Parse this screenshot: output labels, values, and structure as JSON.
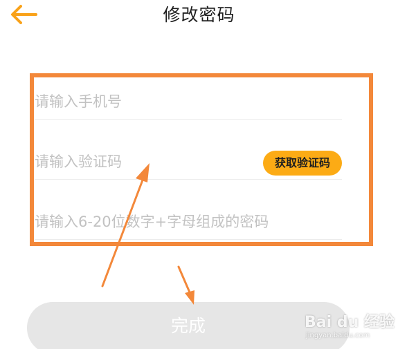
{
  "header": {
    "back_icon": "arrow-left-icon",
    "title": "修改密码"
  },
  "form": {
    "phone_placeholder": "请输入手机号",
    "code_placeholder": "请输入验证码",
    "get_code_label": "获取验证码",
    "password_placeholder": "请输入6-20位数字+字母组成的密码"
  },
  "submit": {
    "label": "完成"
  },
  "watermark": {
    "brand": "Bai du 经验",
    "url": "jingyan.baidu.com"
  },
  "colors": {
    "accent": "#fcab15",
    "back_arrow": "#f9a21a",
    "annotation": "#f3883a",
    "button_disabled": "#e6e6e6"
  }
}
